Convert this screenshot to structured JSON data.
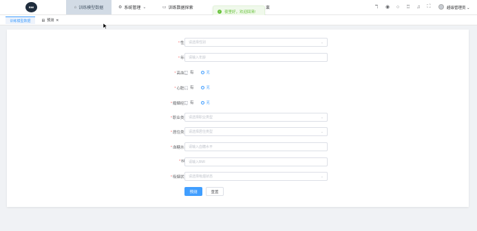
{
  "header": {
    "logo_text": "BMI",
    "menu": [
      {
        "label": "训练模型数据",
        "icon": "home-icon",
        "active": true
      },
      {
        "label": "系统管理",
        "icon": "gear-icon",
        "has_dropdown": true
      },
      {
        "label": "训练数据探索",
        "icon": "chat-icon"
      },
      {
        "label": "束",
        "icon": ""
      }
    ],
    "user_name": "超级管理员",
    "icons": [
      "font-size-icon",
      "github-icon",
      "help-icon",
      "theme-icon",
      "bell-icon",
      "fullscreen-icon"
    ]
  },
  "toast": {
    "message": "夜里好，欢迎回来!",
    "type": "success"
  },
  "tabs": [
    {
      "label": "训练模型数据",
      "active": true
    },
    {
      "label": "预测",
      "closable": true
    }
  ],
  "form": {
    "fields": [
      {
        "key": "gender",
        "label": "性别",
        "type": "select",
        "placeholder": "请选择性别"
      },
      {
        "key": "age",
        "label": "年龄",
        "type": "input",
        "placeholder": "请输入年龄"
      },
      {
        "key": "hypertension",
        "label": "高血压",
        "type": "radio",
        "options": [
          "有",
          "无"
        ],
        "selected": "无"
      },
      {
        "key": "heart_disease",
        "label": "心脏病",
        "type": "radio",
        "options": [
          "有",
          "无"
        ],
        "selected": "无"
      },
      {
        "key": "marriage",
        "label": "婚姻经历",
        "type": "radio",
        "options": [
          "有",
          "无"
        ],
        "selected": "无"
      },
      {
        "key": "work_type",
        "label": "职业类型",
        "type": "select",
        "placeholder": "请选择职业类型"
      },
      {
        "key": "residence",
        "label": "居住类型",
        "type": "select",
        "placeholder": "请选择居住类型"
      },
      {
        "key": "glucose",
        "label": "血糖水平",
        "type": "input",
        "placeholder": "请输入血糖水平"
      },
      {
        "key": "bmi",
        "label": "BMI",
        "type": "input",
        "placeholder": "请输入BMI"
      },
      {
        "key": "smoking",
        "label": "吸烟状态",
        "type": "select",
        "placeholder": "请选择吸烟状态"
      }
    ],
    "predict_label": "预测",
    "reset_label": "重置"
  }
}
